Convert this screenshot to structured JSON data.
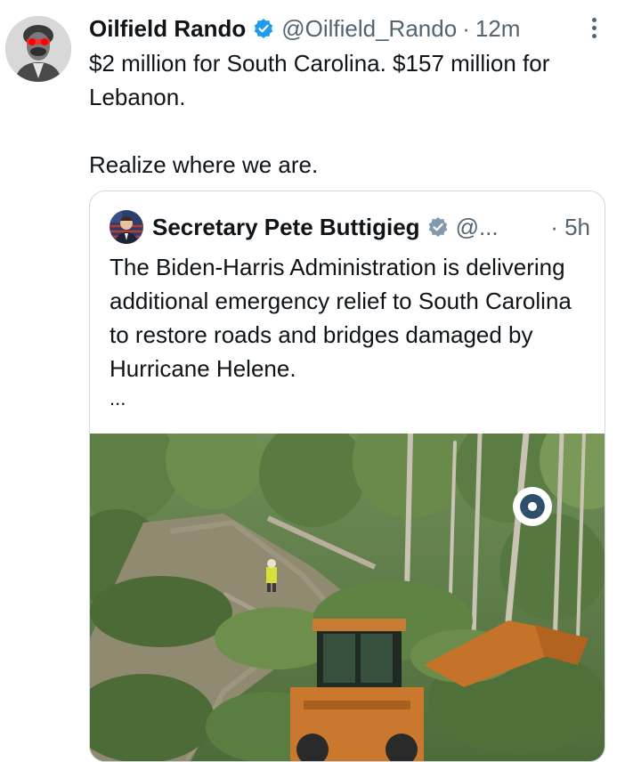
{
  "tweet": {
    "author_name": "Oilfield Rando",
    "handle": "@Oilfield_Rando",
    "separator": "·",
    "time": "12m",
    "text": "$2 million for South Carolina. $157 million for\nLebanon.\n\nRealize where we are."
  },
  "quote": {
    "author_name": "Secretary Pete Buttigieg",
    "handle": "@...",
    "time": "· 5h",
    "text": "The Biden-Harris Administration is delivering additional emergency relief to South Carolina to restore roads and bridges damaged by Hurricane Helene.",
    "ellipsis": "..."
  },
  "colors": {
    "text": "#0f1419",
    "secondary": "#536471",
    "verified": "#1d9bf0",
    "border": "#cfd9de"
  },
  "icons": {
    "verified": "verified-badge-icon",
    "more": "more-options-icon",
    "logo": "usdot-logo-icon"
  }
}
